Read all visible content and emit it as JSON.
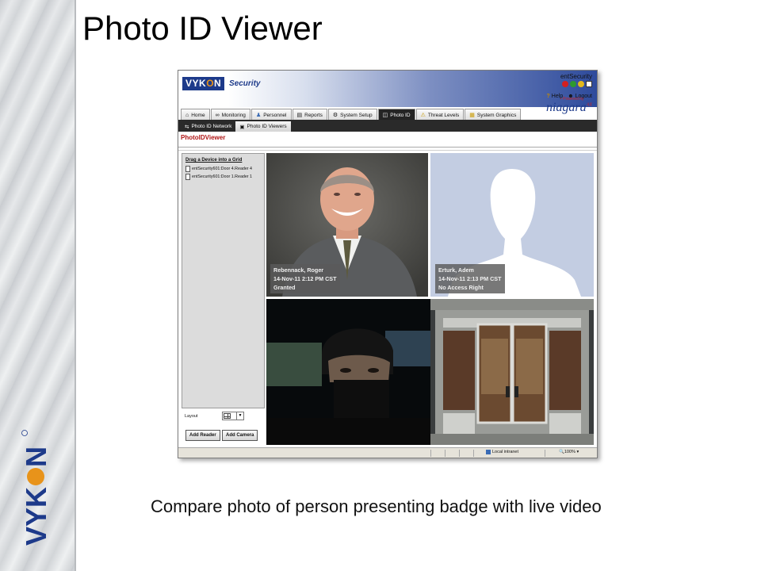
{
  "slide": {
    "title": "Photo ID Viewer",
    "caption": "Compare photo of person presenting badge with live video",
    "logo_text": "VYKON"
  },
  "app": {
    "logo_main": "VYK",
    "logo_o": "O",
    "logo_end": "N",
    "logo_sub": "Security",
    "product": "entSecurity",
    "help_label": "Help",
    "logout_label": "Logout",
    "powered_by": "• Powered by",
    "niagara": "niagara",
    "niagara_ax": "AX",
    "status_colors": [
      "#d42020",
      "#2e9a2e",
      "#e3b91c"
    ]
  },
  "tabs": [
    {
      "label": "Home",
      "icon": "home-icon",
      "active": false
    },
    {
      "label": "Monitoring",
      "icon": "glasses-icon",
      "active": false
    },
    {
      "label": "Personnel",
      "icon": "people-icon",
      "active": false
    },
    {
      "label": "Reports",
      "icon": "report-icon",
      "active": false
    },
    {
      "label": "System Setup",
      "icon": "wrench-icon",
      "active": false
    },
    {
      "label": "Photo ID",
      "icon": "id-card-icon",
      "active": true
    },
    {
      "label": "Threat Levels",
      "icon": "warning-icon",
      "active": false
    },
    {
      "label": "System Graphics",
      "icon": "folder-icon",
      "active": false
    }
  ],
  "sub_tabs": [
    {
      "label": "Photo ID Network",
      "active": false
    },
    {
      "label": "Photo ID Viewers",
      "active": true
    }
  ],
  "page_label": "PhotoIDViewer",
  "device_panel": {
    "title": "Drag a Device into a Grid",
    "devices": [
      "entSecurity601:Door 4.Reader 4",
      "entSecurity601:Door 1.Reader 1"
    ],
    "layout_label": "Layout",
    "add_reader": "Add Reader",
    "add_camera": "Add Camera"
  },
  "grid": [
    {
      "name": "Rebennack, Roger",
      "time": "14-Nov-11 2:12 PM CST",
      "status": "Granted"
    },
    {
      "name": "Erturk, Adem",
      "time": "14-Nov-11 2:13 PM CST",
      "status": "No Access Right"
    }
  ],
  "statusbar": {
    "zone": "Local intranet",
    "zoom": "100%"
  }
}
